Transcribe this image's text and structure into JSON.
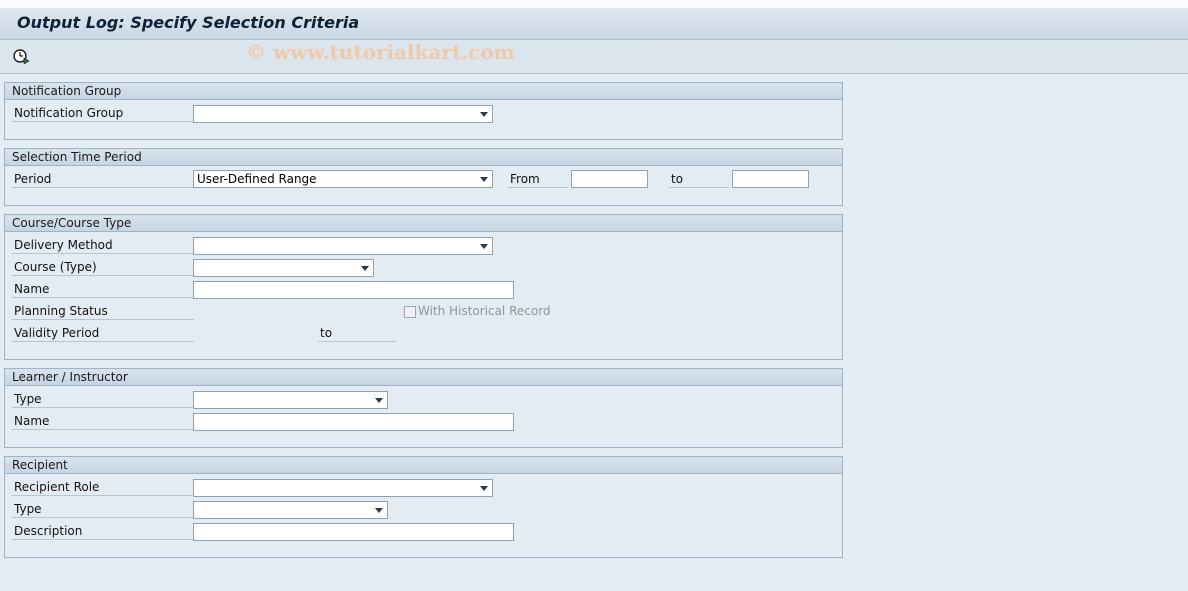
{
  "window": {
    "title": "Output Log: Specify Selection Criteria"
  },
  "toolbar": {
    "execute_icon": "execute-clock-icon"
  },
  "watermark": "© www.tutorialkart.com",
  "groups": {
    "notification_group": {
      "title": "Notification Group",
      "fields": {
        "notification_group": {
          "label": "Notification Group",
          "value": ""
        }
      }
    },
    "selection_time_period": {
      "title": "Selection Time Period",
      "fields": {
        "period": {
          "label": "Period",
          "value": "User-Defined Range"
        },
        "from": {
          "label": "From",
          "value": ""
        },
        "to": {
          "label": "to",
          "value": ""
        }
      }
    },
    "course": {
      "title": "Course/Course Type",
      "fields": {
        "delivery_method": {
          "label": "Delivery Method",
          "value": ""
        },
        "course_type": {
          "label": "Course (Type)",
          "value": ""
        },
        "name": {
          "label": "Name",
          "value": ""
        },
        "planning_status": {
          "label": "Planning Status"
        },
        "with_historical_record": {
          "label": "With Historical Record",
          "checked": false
        },
        "validity_period": {
          "label": "Validity Period",
          "to_label": "to"
        }
      }
    },
    "learner_instructor": {
      "title": "Learner / Instructor",
      "fields": {
        "type": {
          "label": "Type",
          "value": ""
        },
        "name": {
          "label": "Name",
          "value": ""
        }
      }
    },
    "recipient": {
      "title": "Recipient",
      "fields": {
        "recipient_role": {
          "label": "Recipient Role",
          "value": ""
        },
        "type": {
          "label": "Type",
          "value": ""
        },
        "description": {
          "label": "Description",
          "value": ""
        }
      }
    }
  }
}
